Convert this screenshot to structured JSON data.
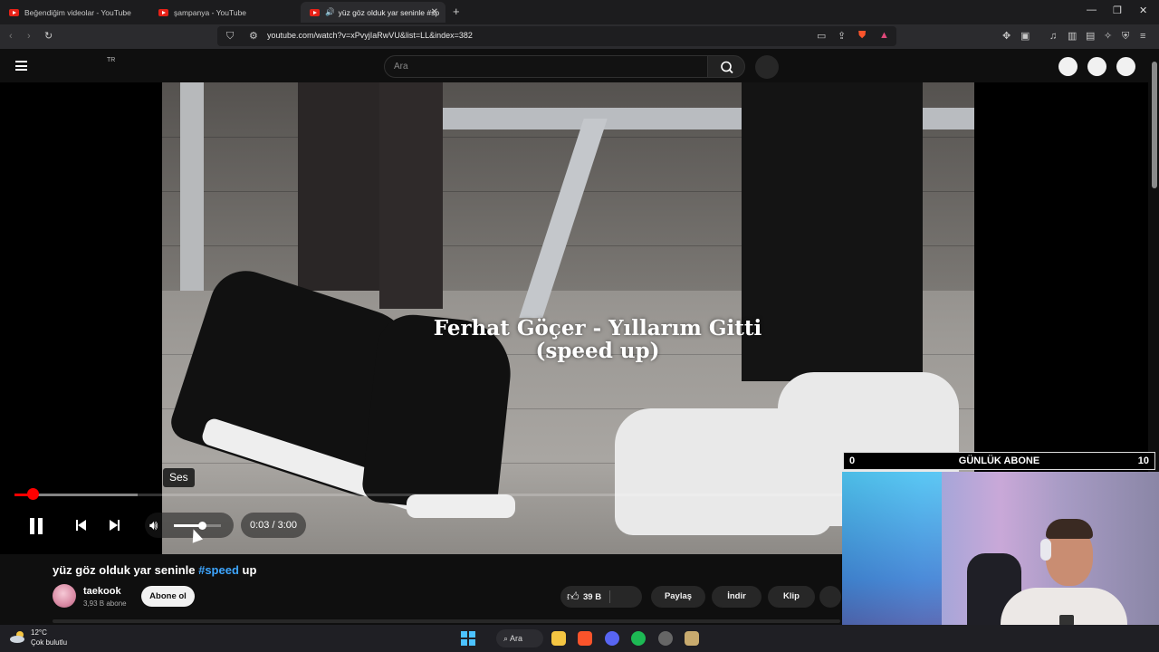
{
  "browser": {
    "tabs": [
      {
        "label": "Beğendiğim videolar - YouTube",
        "active": false
      },
      {
        "label": "şampanya - YouTube",
        "active": false
      },
      {
        "label": "yüz göz olduk yar seninle #sp",
        "active": true
      }
    ],
    "url": "youtube.com/watch?v=xPvyjIaRwVU&list=LL&index=382",
    "new_tab_icon": "plus-icon"
  },
  "youtube": {
    "country_code": "TR",
    "search_placeholder": "Ara"
  },
  "player": {
    "overlay_title_line1": "Ferhat Göçer - Yıllarım Gitti",
    "overlay_title_line2": "(speed up)",
    "tooltip": "Ses",
    "time_display": "0:03 / 3:00",
    "progress_fraction": 0.0167,
    "buffered_fraction": 0.109,
    "volume_fraction": 0.6
  },
  "video": {
    "title_prefix": "yüz göz olduk yar seninle ",
    "title_hashtag": "#speed",
    "title_suffix": " up",
    "channel": "taekook",
    "subscribers": "3,93 B abone",
    "subscribe_label": "Abone ol",
    "likes": "39 B",
    "share_label": "Paylaş",
    "download_label": "İndir",
    "clip_label": "Klip"
  },
  "overlay": {
    "sub_goal_min": "0",
    "sub_goal_title": "GÜNLÜK ABONE",
    "sub_goal_max": "10"
  },
  "taskbar": {
    "temperature": "12°C",
    "weather": "Çok bulutlu",
    "search_label": "Ara"
  },
  "colors": {
    "accent": "#ff0000",
    "hashtag": "#3ea6ff",
    "background": "#0f0f0f"
  }
}
